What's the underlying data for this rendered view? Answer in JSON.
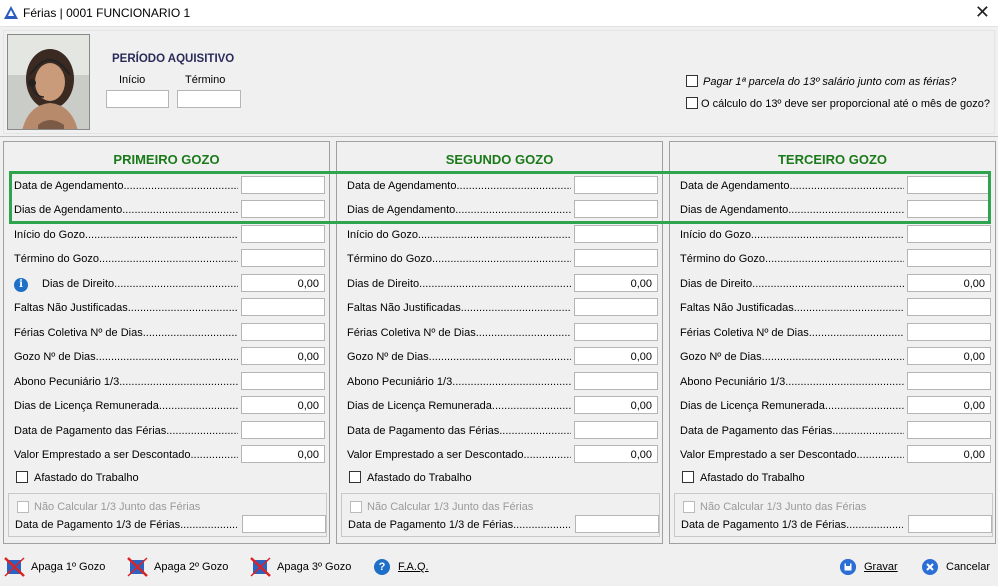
{
  "window": {
    "title": "Férias | 0001 FUNCIONARIO 1"
  },
  "periodo": {
    "title": "PERÍODO AQUISITIVO",
    "inicio_label": "Início",
    "termino_label": "Término",
    "inicio_value": "",
    "termino_value": ""
  },
  "options": {
    "pagar_label": "Pagar 1ª parcela do 13º salário junto com as férias?",
    "calculo_label": "O cálculo do 13º deve ser proporcional até o mês de gozo?"
  },
  "panels": [
    {
      "title": "PRIMEIRO GOZO",
      "fields": [
        {
          "label": "Data de Agendamento......................................................",
          "value": ""
        },
        {
          "label": "Dias de Agendamento......................................................",
          "value": ""
        },
        {
          "label": "Início do Gozo.................................................................",
          "value": ""
        },
        {
          "label": "Término do Gozo.............................................................",
          "value": ""
        },
        {
          "label": "Dias de Direito.........................................................",
          "value": "0,00"
        },
        {
          "label": "Faltas Não Justificadas..................................................",
          "value": ""
        },
        {
          "label": "Férias Coletiva Nº de Dias..............................................",
          "value": ""
        },
        {
          "label": "Gozo Nº de Dias...............................................................",
          "value": "0,00"
        },
        {
          "label": "Abono Pecuniário 1/3..........................................................",
          "value": ""
        },
        {
          "label": "Dias de Licença Remunerada...............................................",
          "value": "0,00"
        },
        {
          "label": "Data de Pagamento das Férias...............................................",
          "value": ""
        },
        {
          "label": "Valor Emprestado a ser Descontado.........................................",
          "value": "0,00"
        }
      ],
      "afastado": "Afastado do Trabalho",
      "nao_calcular": "Não Calcular 1/3 Junto das Férias",
      "data_pagamento_13": "Data de Pagamento 1/3 de Férias..................................",
      "data_pagamento_13_value": ""
    },
    {
      "title": "SEGUNDO GOZO",
      "fields": [
        {
          "label": "Data de Agendamento......................................................",
          "value": ""
        },
        {
          "label": "Dias de Agendamento......................................................",
          "value": ""
        },
        {
          "label": "Início do Gozo.................................................................",
          "value": ""
        },
        {
          "label": "Término do Gozo.............................................................",
          "value": ""
        },
        {
          "label": "Dias de Direito..................................................................",
          "value": "0,00"
        },
        {
          "label": "Faltas Não Justificadas..................................................",
          "value": ""
        },
        {
          "label": "Férias Coletiva Nº de Dias..............................................",
          "value": ""
        },
        {
          "label": "Gozo Nº de Dias...............................................................",
          "value": "0,00"
        },
        {
          "label": "Abono Pecuniário 1/3..........................................................",
          "value": ""
        },
        {
          "label": "Dias de Licença Remunerada...............................................",
          "value": "0,00"
        },
        {
          "label": "Data de Pagamento das Férias...............................................",
          "value": ""
        },
        {
          "label": "Valor Emprestado a ser Descontado.........................................",
          "value": "0,00"
        }
      ],
      "afastado": "Afastado do Trabalho",
      "nao_calcular": "Não Calcular 1/3 Junto das Férias",
      "data_pagamento_13": "Data de Pagamento 1/3 de Férias..................................",
      "data_pagamento_13_value": ""
    },
    {
      "title": "TERCEIRO GOZO",
      "fields": [
        {
          "label": "Data de Agendamento......................................................",
          "value": ""
        },
        {
          "label": "Dias de Agendamento......................................................",
          "value": ""
        },
        {
          "label": "Início do Gozo.................................................................",
          "value": ""
        },
        {
          "label": "Término do Gozo.............................................................",
          "value": ""
        },
        {
          "label": "Dias de Direito..................................................................",
          "value": "0,00"
        },
        {
          "label": "Faltas Não Justificadas..................................................",
          "value": ""
        },
        {
          "label": "Férias Coletiva Nº de Dias..............................................",
          "value": ""
        },
        {
          "label": "Gozo Nº de Dias...............................................................",
          "value": "0,00"
        },
        {
          "label": "Abono Pecuniário 1/3..........................................................",
          "value": ""
        },
        {
          "label": "Dias de Licença Remunerada...............................................",
          "value": "0,00"
        },
        {
          "label": "Data de Pagamento das Férias...............................................",
          "value": ""
        },
        {
          "label": "Valor Emprestado a ser Descontado.........................................",
          "value": "0,00"
        }
      ],
      "afastado": "Afastado do Trabalho",
      "nao_calcular": "Não Calcular 1/3 Junto das Férias",
      "data_pagamento_13": "Data de Pagamento 1/3 de Férias..................................",
      "data_pagamento_13_value": ""
    }
  ],
  "toolbar": {
    "apaga1": "Apaga 1º Gozo",
    "apaga2": "Apaga 2º Gozo",
    "apaga3": "Apaga 3º Gozo",
    "faq": "F.A.Q.",
    "gravar": "Gravar",
    "cancelar": "Cancelar"
  },
  "colors": {
    "panel_title": "#1a7a1a",
    "highlight": "#2ea44f",
    "info_icon": "#1e6fc7"
  }
}
